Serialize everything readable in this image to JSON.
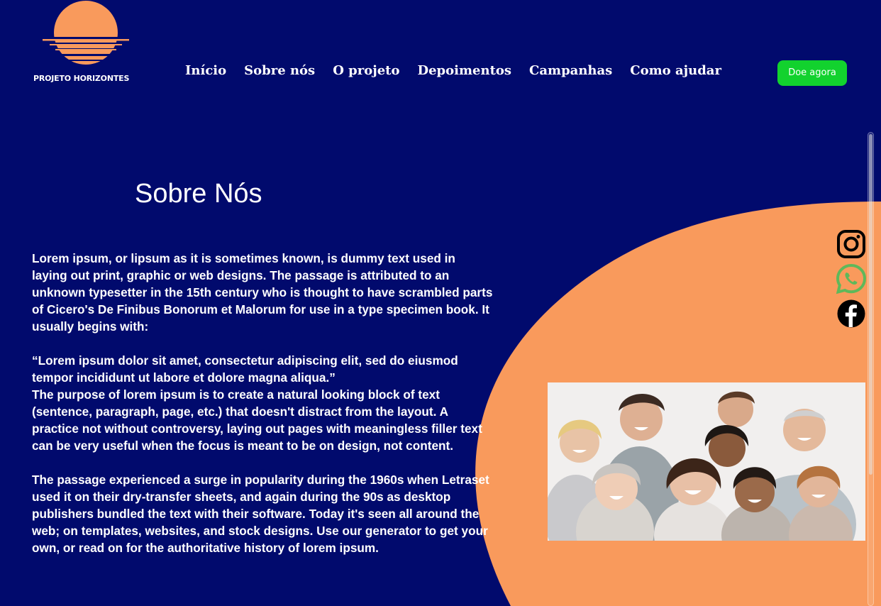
{
  "header": {
    "logo_text": "PROJETO HORIZONTES",
    "nav": [
      {
        "label": "Início"
      },
      {
        "label": "Sobre nós"
      },
      {
        "label": "O projeto"
      },
      {
        "label": "Depoimentos"
      },
      {
        "label": "Campanhas"
      },
      {
        "label": "Como ajudar"
      }
    ],
    "donate_label": "Doe agora"
  },
  "main": {
    "title": "Sobre Nós",
    "paragraphs": [
      "Lorem ipsum, or lipsum as it is sometimes known, is dummy text used in laying out print, graphic or web designs. The passage is attributed to an unknown typesetter in the 15th century who is thought to have scrambled parts of Cicero's De Finibus Bonorum et Malorum for use in a type specimen book. It usually begins with:",
      "“Lorem ipsum dolor sit amet, consectetur adipiscing elit, sed do eiusmod tempor incididunt ut labore et dolore magna aliqua.”",
      "The purpose of lorem ipsum is to create a natural looking block of text (sentence, paragraph, page, etc.) that doesn't distract from the layout. A practice not without controversy, laying out pages with meaningless filler text can be very useful when the focus is meant to be on design, not content.",
      "The passage experienced a surge in popularity during the 1960s when Letraset used it on their dry-transfer sheets, and again during the 90s as desktop publishers bundled the text with their software. Today it's seen all around the web; on templates, websites, and stock designs. Use our generator to get your own, or read on for the authoritative history of lorem ipsum."
    ]
  },
  "social": {
    "icons": [
      "instagram-icon",
      "whatsapp-icon",
      "facebook-icon"
    ]
  },
  "colors": {
    "background": "#010a6d",
    "accent_orange": "#f99a5c",
    "donate_green": "#12d22e",
    "whatsapp_green": "#5fb85a"
  }
}
